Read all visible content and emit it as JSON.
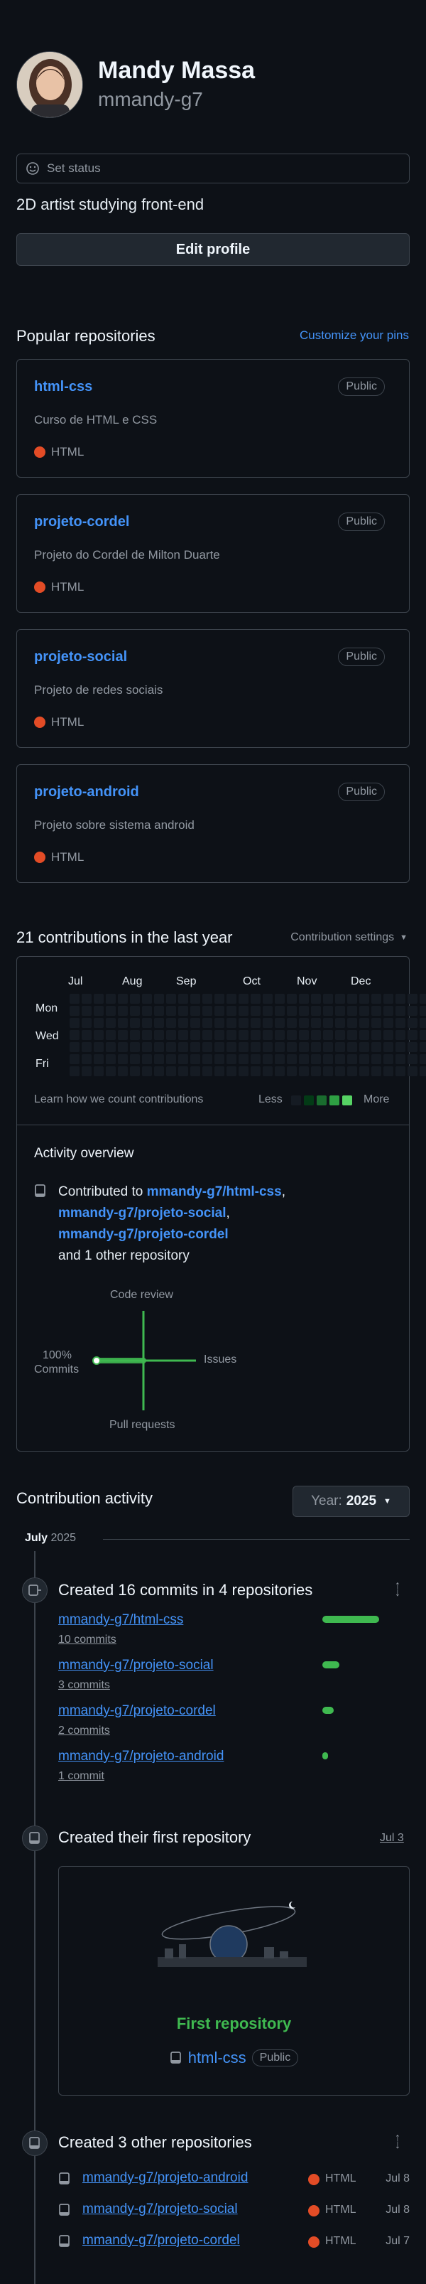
{
  "profile": {
    "name": "Mandy Massa",
    "username": "mmandy-g7",
    "status_label": "Set status",
    "bio": "2D artist studying front-end",
    "edit_label": "Edit profile"
  },
  "pinned": {
    "title": "Popular repositories",
    "customize_label": "Customize your pins",
    "repos": [
      {
        "name": "html-css",
        "visibility": "Public",
        "description": "Curso de HTML e CSS",
        "language": "HTML"
      },
      {
        "name": "projeto-cordel",
        "visibility": "Public",
        "description": "Projeto do Cordel de Milton Duarte",
        "language": "HTML"
      },
      {
        "name": "projeto-social",
        "visibility": "Public",
        "description": "Projeto de redes sociais",
        "language": "HTML"
      },
      {
        "name": "projeto-android",
        "visibility": "Public",
        "description": "Projeto sobre sistema android",
        "language": "HTML"
      }
    ],
    "language_color": "#e34c26"
  },
  "contributions": {
    "title": "21 contributions in the last year",
    "settings_label": "Contribution settings",
    "months": [
      "Jul",
      "Aug",
      "Sep",
      "Oct",
      "Nov",
      "Dec"
    ],
    "days": [
      "Mon",
      "Wed",
      "Fri"
    ],
    "learn_label": "Learn how we count contributions",
    "less_label": "Less",
    "more_label": "More",
    "legend_colors": [
      "#151b23",
      "#033a16",
      "#196c2e",
      "#2ea043",
      "#56d364"
    ]
  },
  "activity_overview": {
    "title": "Activity overview",
    "contributed_prefix": "Contributed to",
    "repos": [
      "mmandy-g7/html-css",
      "mmandy-g7/projeto-social",
      "mmandy-g7/projeto-cordel"
    ],
    "other_text": "and 1 other repository",
    "axis": {
      "top": "Code review",
      "right": "Issues",
      "bottom": "Pull requests",
      "left_pct": "100%",
      "left": "Commits"
    }
  },
  "contribution_activity": {
    "title": "Contribution activity",
    "year_prefix": "Year:",
    "year": "2025",
    "month": "July",
    "month_year": "2025",
    "commits_event": {
      "title": "Created 16 commits in 4 repositories",
      "items": [
        {
          "repo": "mmandy-g7/html-css",
          "commits": "10 commits",
          "share": 0.625
        },
        {
          "repo": "mmandy-g7/projeto-social",
          "commits": "3 commits",
          "share": 0.1875
        },
        {
          "repo": "mmandy-g7/projeto-cordel",
          "commits": "2 commits",
          "share": 0.125
        },
        {
          "repo": "mmandy-g7/projeto-android",
          "commits": "1 commit",
          "share": 0.0625
        }
      ]
    },
    "first_repo_event": {
      "title": "Created their first repository",
      "date": "Jul 3",
      "card_title": "First repository",
      "repo": "html-css",
      "visibility": "Public"
    },
    "other_repos_event": {
      "title": "Created 3 other repositories",
      "items": [
        {
          "repo": "mmandy-g7/projeto-android",
          "language": "HTML",
          "date": "Jul 8"
        },
        {
          "repo": "mmandy-g7/projeto-social",
          "language": "HTML",
          "date": "Jul 8"
        },
        {
          "repo": "mmandy-g7/projeto-cordel",
          "language": "HTML",
          "date": "Jul 7"
        }
      ]
    }
  }
}
